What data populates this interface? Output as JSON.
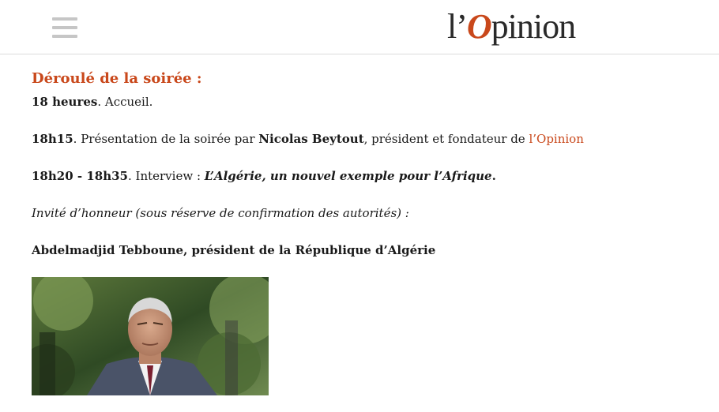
{
  "header": {
    "menu_icon": "hamburger-menu-icon",
    "logo": {
      "prefix": "l’",
      "o": "O",
      "suffix": "pinion"
    }
  },
  "program": {
    "title": "Déroulé de la soirée :",
    "p1": {
      "time": "18 heures",
      "text": ". Accueil."
    },
    "p2": {
      "time": "18h15",
      "text1": ". Présentation de la soirée par ",
      "name": "Nicolas Beytout",
      "text2": ", président et fondateur de ",
      "link": "l’Opinion"
    },
    "p3": {
      "time": "18h20 - 18h35",
      "text1": ". Interview : ",
      "title": "L’Algérie, un nouvel exemple pour l’Afrique",
      "end": "."
    },
    "guest_intro": "Invité d’honneur (sous réserve de confirmation des autorités) :",
    "guest": {
      "name": "Abdelmadjid Tebboune",
      "role": ", président de la République d’Algérie"
    }
  },
  "colors": {
    "accent": "#c9481b",
    "menu_icon": "#c6c6c6",
    "text": "#1a1a1a"
  }
}
